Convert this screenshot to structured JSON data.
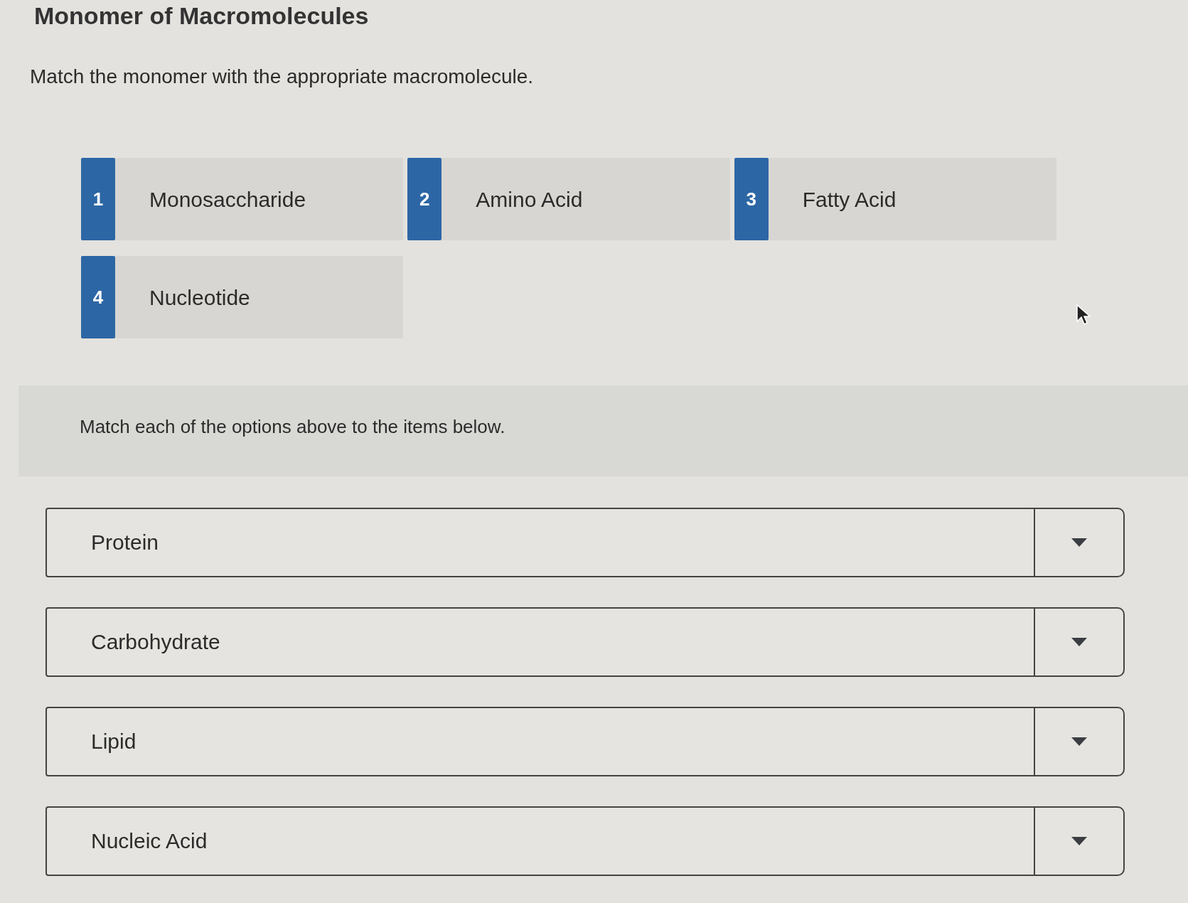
{
  "title": "Monomer of Macromolecules",
  "instruction": "Match the monomer with the appropriate macromolecule.",
  "options": [
    {
      "number": "1",
      "label": "Monosaccharide"
    },
    {
      "number": "2",
      "label": "Amino Acid"
    },
    {
      "number": "3",
      "label": "Fatty Acid"
    },
    {
      "number": "4",
      "label": "Nucleotide"
    }
  ],
  "matching": {
    "prompt": "Match each of the options above to the items below.",
    "items": [
      {
        "label": "Protein"
      },
      {
        "label": "Carbohydrate"
      },
      {
        "label": "Lipid"
      },
      {
        "label": "Nucleic Acid"
      }
    ]
  }
}
